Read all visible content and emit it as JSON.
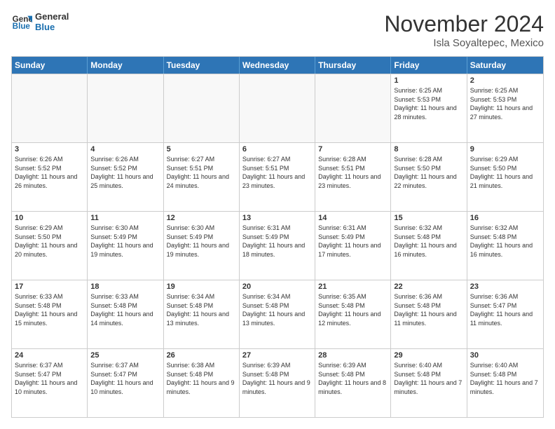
{
  "logo": {
    "general": "General",
    "blue": "Blue"
  },
  "title": "November 2024",
  "location": "Isla Soyaltepec, Mexico",
  "weekdays": [
    "Sunday",
    "Monday",
    "Tuesday",
    "Wednesday",
    "Thursday",
    "Friday",
    "Saturday"
  ],
  "rows": [
    [
      {
        "day": "",
        "empty": true
      },
      {
        "day": "",
        "empty": true
      },
      {
        "day": "",
        "empty": true
      },
      {
        "day": "",
        "empty": true
      },
      {
        "day": "",
        "empty": true
      },
      {
        "day": "1",
        "sunrise": "6:25 AM",
        "sunset": "5:53 PM",
        "daylight": "11 hours and 28 minutes."
      },
      {
        "day": "2",
        "sunrise": "6:25 AM",
        "sunset": "5:53 PM",
        "daylight": "11 hours and 27 minutes."
      }
    ],
    [
      {
        "day": "3",
        "sunrise": "6:26 AM",
        "sunset": "5:52 PM",
        "daylight": "11 hours and 26 minutes."
      },
      {
        "day": "4",
        "sunrise": "6:26 AM",
        "sunset": "5:52 PM",
        "daylight": "11 hours and 25 minutes."
      },
      {
        "day": "5",
        "sunrise": "6:27 AM",
        "sunset": "5:51 PM",
        "daylight": "11 hours and 24 minutes."
      },
      {
        "day": "6",
        "sunrise": "6:27 AM",
        "sunset": "5:51 PM",
        "daylight": "11 hours and 23 minutes."
      },
      {
        "day": "7",
        "sunrise": "6:28 AM",
        "sunset": "5:51 PM",
        "daylight": "11 hours and 23 minutes."
      },
      {
        "day": "8",
        "sunrise": "6:28 AM",
        "sunset": "5:50 PM",
        "daylight": "11 hours and 22 minutes."
      },
      {
        "day": "9",
        "sunrise": "6:29 AM",
        "sunset": "5:50 PM",
        "daylight": "11 hours and 21 minutes."
      }
    ],
    [
      {
        "day": "10",
        "sunrise": "6:29 AM",
        "sunset": "5:50 PM",
        "daylight": "11 hours and 20 minutes."
      },
      {
        "day": "11",
        "sunrise": "6:30 AM",
        "sunset": "5:49 PM",
        "daylight": "11 hours and 19 minutes."
      },
      {
        "day": "12",
        "sunrise": "6:30 AM",
        "sunset": "5:49 PM",
        "daylight": "11 hours and 19 minutes."
      },
      {
        "day": "13",
        "sunrise": "6:31 AM",
        "sunset": "5:49 PM",
        "daylight": "11 hours and 18 minutes."
      },
      {
        "day": "14",
        "sunrise": "6:31 AM",
        "sunset": "5:49 PM",
        "daylight": "11 hours and 17 minutes."
      },
      {
        "day": "15",
        "sunrise": "6:32 AM",
        "sunset": "5:48 PM",
        "daylight": "11 hours and 16 minutes."
      },
      {
        "day": "16",
        "sunrise": "6:32 AM",
        "sunset": "5:48 PM",
        "daylight": "11 hours and 16 minutes."
      }
    ],
    [
      {
        "day": "17",
        "sunrise": "6:33 AM",
        "sunset": "5:48 PM",
        "daylight": "11 hours and 15 minutes."
      },
      {
        "day": "18",
        "sunrise": "6:33 AM",
        "sunset": "5:48 PM",
        "daylight": "11 hours and 14 minutes."
      },
      {
        "day": "19",
        "sunrise": "6:34 AM",
        "sunset": "5:48 PM",
        "daylight": "11 hours and 13 minutes."
      },
      {
        "day": "20",
        "sunrise": "6:34 AM",
        "sunset": "5:48 PM",
        "daylight": "11 hours and 13 minutes."
      },
      {
        "day": "21",
        "sunrise": "6:35 AM",
        "sunset": "5:48 PM",
        "daylight": "11 hours and 12 minutes."
      },
      {
        "day": "22",
        "sunrise": "6:36 AM",
        "sunset": "5:48 PM",
        "daylight": "11 hours and 11 minutes."
      },
      {
        "day": "23",
        "sunrise": "6:36 AM",
        "sunset": "5:47 PM",
        "daylight": "11 hours and 11 minutes."
      }
    ],
    [
      {
        "day": "24",
        "sunrise": "6:37 AM",
        "sunset": "5:47 PM",
        "daylight": "11 hours and 10 minutes."
      },
      {
        "day": "25",
        "sunrise": "6:37 AM",
        "sunset": "5:47 PM",
        "daylight": "11 hours and 10 minutes."
      },
      {
        "day": "26",
        "sunrise": "6:38 AM",
        "sunset": "5:48 PM",
        "daylight": "11 hours and 9 minutes."
      },
      {
        "day": "27",
        "sunrise": "6:39 AM",
        "sunset": "5:48 PM",
        "daylight": "11 hours and 9 minutes."
      },
      {
        "day": "28",
        "sunrise": "6:39 AM",
        "sunset": "5:48 PM",
        "daylight": "11 hours and 8 minutes."
      },
      {
        "day": "29",
        "sunrise": "6:40 AM",
        "sunset": "5:48 PM",
        "daylight": "11 hours and 7 minutes."
      },
      {
        "day": "30",
        "sunrise": "6:40 AM",
        "sunset": "5:48 PM",
        "daylight": "11 hours and 7 minutes."
      }
    ]
  ]
}
